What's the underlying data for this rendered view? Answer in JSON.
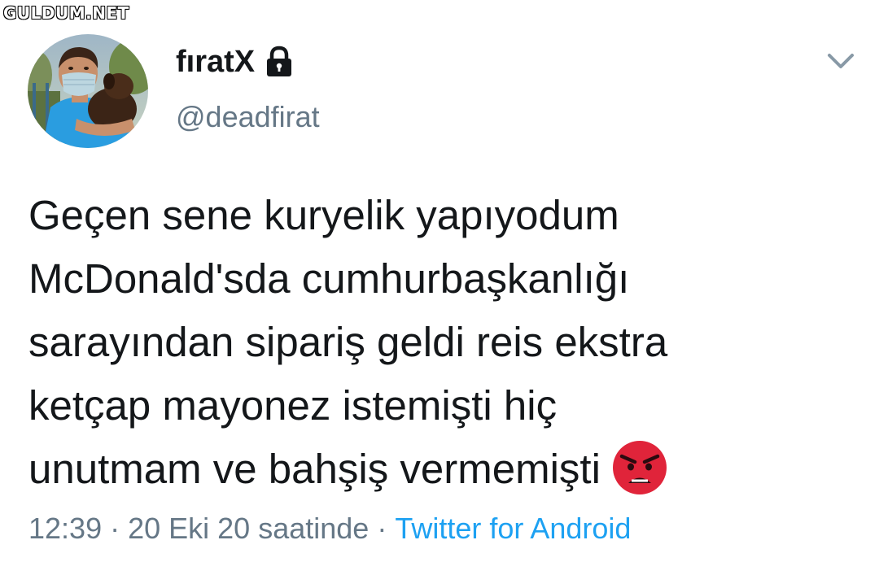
{
  "watermark": "GULDUM.NET",
  "tweet": {
    "display_name": "fıratX",
    "handle": "@deadfirat",
    "locked": true,
    "text_lines": [
      "Geçen sene kuryelik yapıyodum",
      "McDonald'sda cumhurbaşkanlığı",
      "sarayından sipariş geldi reis ekstra",
      "ketçap mayonez istemişti hiç",
      "unutmam ve bahşiş vermemişti"
    ],
    "trailing_emoji": "angry-face",
    "time": "12:39",
    "date": "20 Eki 20 saatinde",
    "separator": "·",
    "source": "Twitter for Android"
  },
  "icons": {
    "lock": "lock-icon",
    "caret": "chevron-down-icon",
    "avatar": "avatar"
  },
  "colors": {
    "text_primary": "#14171a",
    "text_secondary": "#657786",
    "link": "#1da1f2",
    "emoji_red": "#e0243a"
  }
}
